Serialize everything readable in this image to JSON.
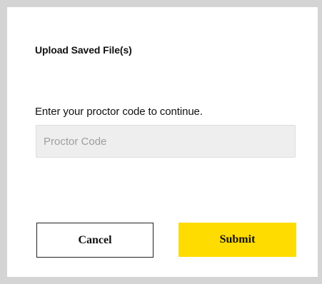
{
  "dialog": {
    "title": "Upload Saved File(s)",
    "instruction": "Enter your proctor code to continue.",
    "proctor_code": {
      "value": "",
      "placeholder": "Proctor Code"
    },
    "cancel_label": "Cancel",
    "submit_label": "Submit"
  },
  "colors": {
    "backdrop": "#d4d4d4",
    "dialog_background": "#ffffff",
    "input_background": "#eeeeee",
    "submit_accent": "#ffdc00"
  }
}
